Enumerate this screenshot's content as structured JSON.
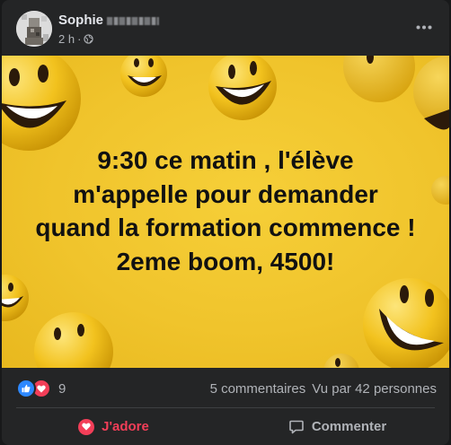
{
  "post": {
    "author": "Sophie",
    "timestamp": "2 h",
    "separator": "·",
    "audience_icon": "globe-icon",
    "menu_icon": "more-options-icon"
  },
  "image_text": {
    "lines": [
      "9:30 ce matin , l'élève",
      "m'appelle pour demander",
      "quand la formation commence !",
      "2eme boom, 4500!"
    ]
  },
  "stats": {
    "reaction_icons": [
      "like-icon",
      "love-icon"
    ],
    "reaction_count": "9",
    "comments": "5 commentaires",
    "views": "Vu par 42 personnes"
  },
  "actions": {
    "love_label": "J'adore",
    "comment_label": "Commenter"
  },
  "colors": {
    "card_bg": "#242526",
    "page_bg": "#18191a",
    "image_yellow": "#f0c42c",
    "love_red": "#f33e58",
    "like_blue": "#2d88ff"
  }
}
